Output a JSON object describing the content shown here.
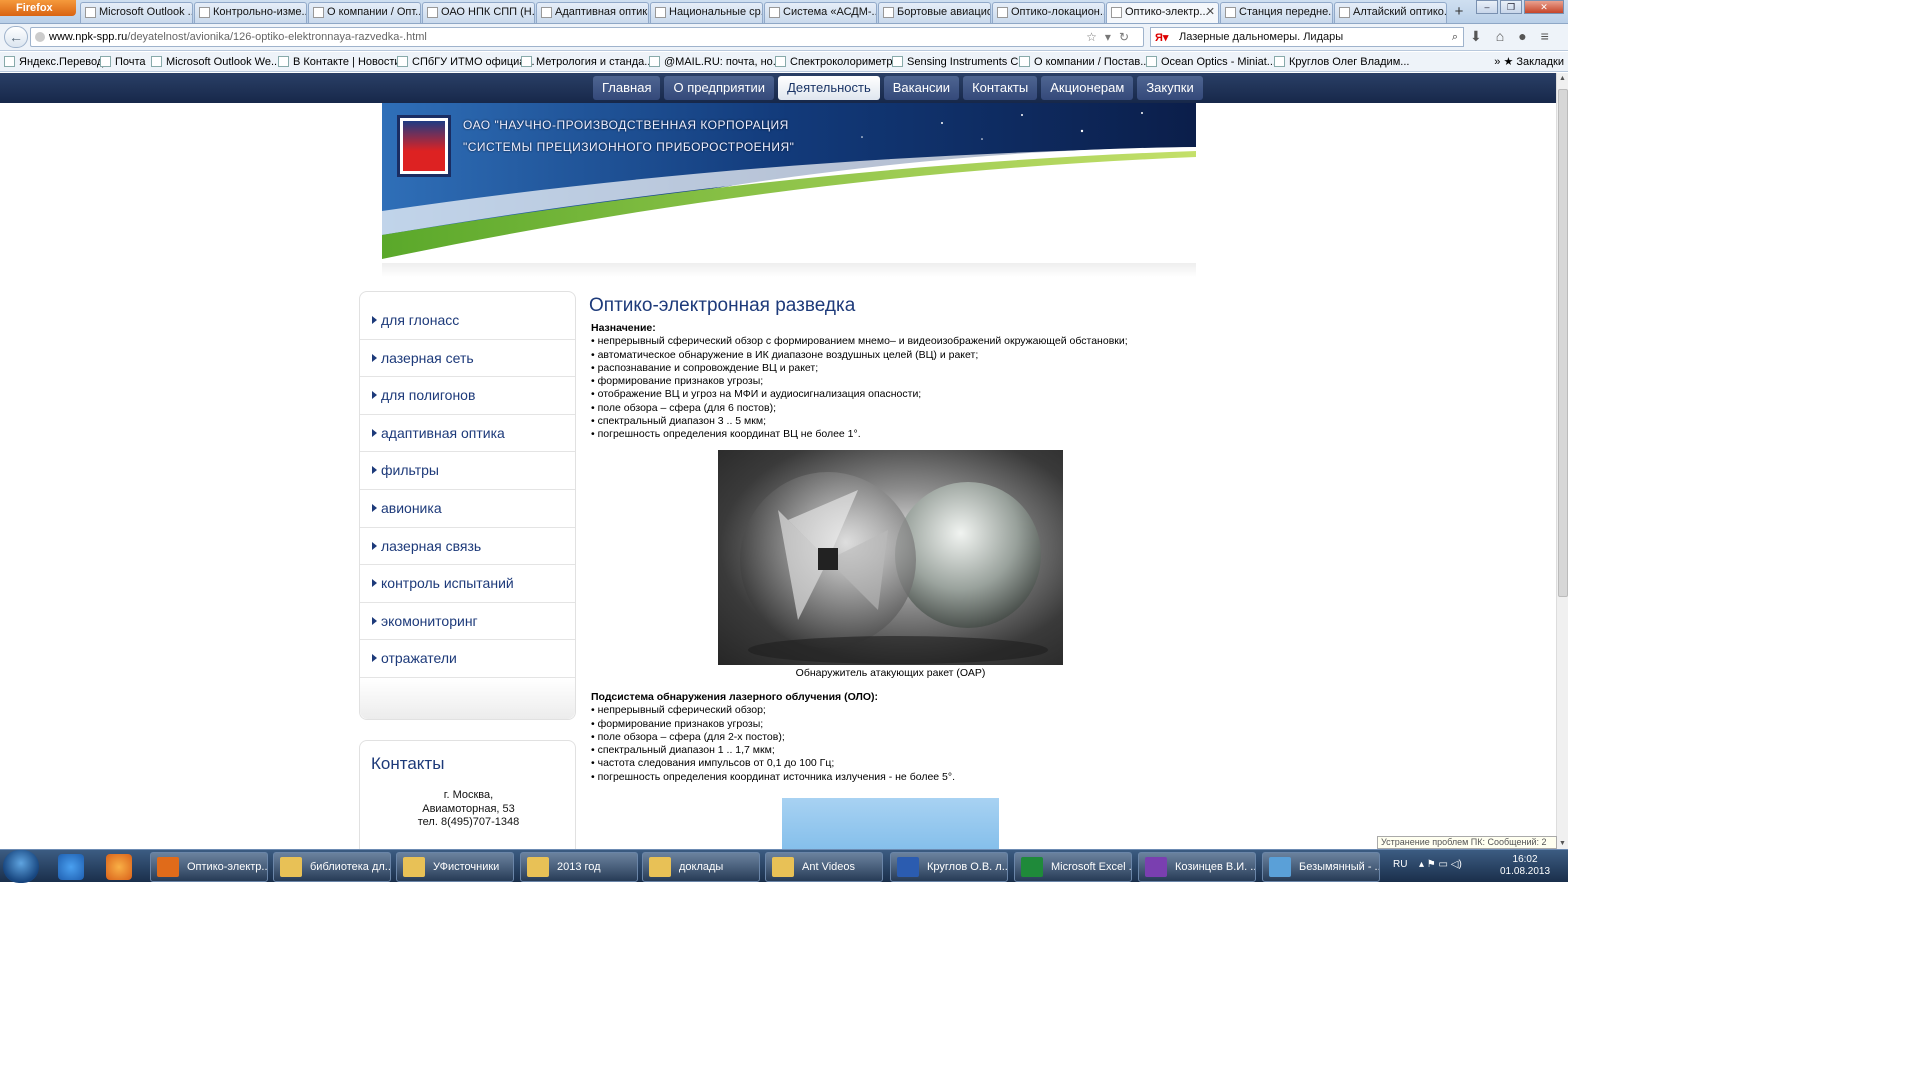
{
  "browser": {
    "menu_button": "Firefox",
    "tabs": [
      "Microsoft Outlook ...",
      "Контрольно-изме...",
      "О компании / Опт...",
      "ОАО НПК СПП (Н...",
      "Адаптивная оптика",
      "Национальные ср...",
      "Система «АСДМ-...",
      "Бортовые авиацио...",
      "Оптико-локацион...",
      "Оптико-электр...",
      "Станция передне...",
      "Алтайский оптико..."
    ],
    "active_tab_index": 9,
    "new_tab": "+",
    "url_host": "www.npk-spp.ru",
    "url_path": "/deyatelnost/avionika/126-optiko-elektronnaya-razvedka-.html",
    "search_text": "Лазерные дальномеры. Лидары",
    "bookmarks": [
      "Яндекс.Перевод",
      "Почта",
      "Microsoft Outlook We...",
      "В Контакте | Новости",
      "СПбГУ ИТМО официа...",
      "Метрология и станда...",
      "@MAIL.RU: почта, но...",
      "Спектроколориметр",
      "Sensing Instruments C...",
      "О компании / Постав...",
      "Ocean Optics - Miniat...",
      "Круглов Олег Владим..."
    ],
    "bookmarks_folder": "Закладки"
  },
  "site": {
    "nav": [
      "Главная",
      "О предприятии",
      "Деятельность",
      "Вакансии",
      "Контакты",
      "Акционерам",
      "Закупки"
    ],
    "nav_active_index": 2,
    "org_line1": "ОАО \"НАУЧНО-ПРОИЗВОДСТВЕННАЯ КОРПОРАЦИЯ",
    "org_line2": "\"СИСТЕМЫ ПРЕЦИЗИОННОГО ПРИБОРОСТРОЕНИЯ\"",
    "sidebar": [
      "для глонасс",
      "лазерная сеть",
      "для полигонов",
      "адаптивная оптика",
      "фильтры",
      "авионика",
      "лазерная связь",
      "контроль испытаний",
      "экомониторинг",
      "отражатели"
    ],
    "contacts": {
      "title": "Контакты",
      "city": "г. Москва,",
      "street": "Авиамоторная, 53",
      "phone": "тел.  8(495)707-1348"
    }
  },
  "article": {
    "title": "Оптико-электронная разведка",
    "purpose_label": "Назначение:",
    "purpose_items": [
      "• непрерывный сферический обзор с формированием мнемо– и видеоизображений окружающей обстановки;",
      "• автоматическое обнаружение в ИК диапазоне воздушных целей  (ВЦ) и ракет;",
      "• распознавание и сопровождение ВЦ и ракет;",
      "• формирование признаков угрозы;",
      "• отображение ВЦ и угроз на МФИ и аудиосигнализация опасности;",
      "• поле обзора – сфера (для 6 постов);",
      "• спектральный диапазон 3 .. 5 мкм;",
      "• погрешность определения координат ВЦ  не более 1°."
    ],
    "figure_caption": "Обнаружитель атакующих ракет (ОАР)",
    "subsystem_label": "Подсистема обнаружения лазерного облучения (ОЛО):",
    "subsystem_items": [
      "• непрерывный сферический обзор;",
      "• формирование признаков угрозы;",
      "• поле обзора – сфера (для 2-х постов);",
      "• спектральный диапазон 1 .. 1,7 мкм;",
      "• частота следования импульсов  от 0,1 до 100 Гц;",
      "• погрешность определения координат источника излучения - не более 5°."
    ]
  },
  "notification": "Устранение проблем ПК: Сообщений: 2",
  "taskbar": {
    "tasks": [
      "Оптико-электр...",
      "библиотека дл...",
      "УФисточники",
      "2013 год",
      "доклады",
      "Ant Videos",
      "Круглов О.В. л...",
      "Microsoft Excel ...",
      "Козинцев В.И. ...",
      "Безымянный - ..."
    ],
    "lang": "RU",
    "time": "16:02",
    "date": "01.08.2013"
  },
  "colors": {
    "link_blue": "#1d3a7a",
    "nav_bg": "#1f3256",
    "active_nav": "#ffffff"
  }
}
